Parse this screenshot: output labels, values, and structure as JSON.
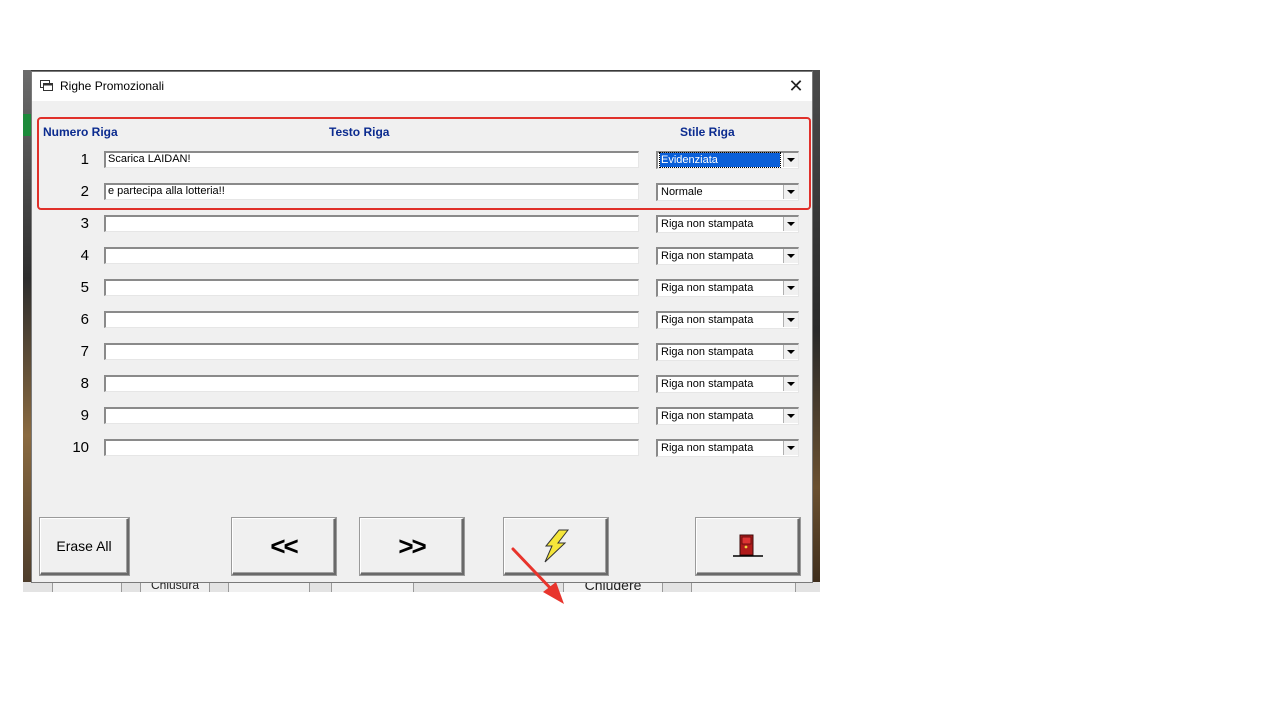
{
  "dialog": {
    "title": "Righe Promozionali",
    "close_glyph": "✕"
  },
  "headers": {
    "numero": "Numero Riga",
    "testo": "Testo Riga",
    "stile": "Stile Riga"
  },
  "rows": [
    {
      "number": "1",
      "text": "Scarica LAIDAN!",
      "style": "Evidenziata",
      "selected": true
    },
    {
      "number": "2",
      "text": "e partecipa alla lotteria!!",
      "style": "Normale"
    },
    {
      "number": "3",
      "text": "",
      "style": "Riga non stampata"
    },
    {
      "number": "4",
      "text": "",
      "style": "Riga non stampata"
    },
    {
      "number": "5",
      "text": "",
      "style": "Riga non stampata"
    },
    {
      "number": "6",
      "text": "",
      "style": "Riga non stampata"
    },
    {
      "number": "7",
      "text": "",
      "style": "Riga non stampata"
    },
    {
      "number": "8",
      "text": "",
      "style": "Riga non stampata"
    },
    {
      "number": "9",
      "text": "",
      "style": "Riga non stampata"
    },
    {
      "number": "10",
      "text": "",
      "style": "Riga non stampata"
    }
  ],
  "buttons": {
    "erase_all": "Erase All",
    "prev": "<<",
    "next": ">>",
    "execute_icon": "lightning-icon",
    "exit_icon": "door-exit-icon"
  },
  "background": {
    "chiusura": "Chiusura",
    "chiudere": "Chiudere"
  },
  "colors": {
    "header_text": "#0b2b8f",
    "highlight_border": "#e0302a",
    "selection": "#0a5fd8",
    "lightning": "#f5e63a"
  }
}
